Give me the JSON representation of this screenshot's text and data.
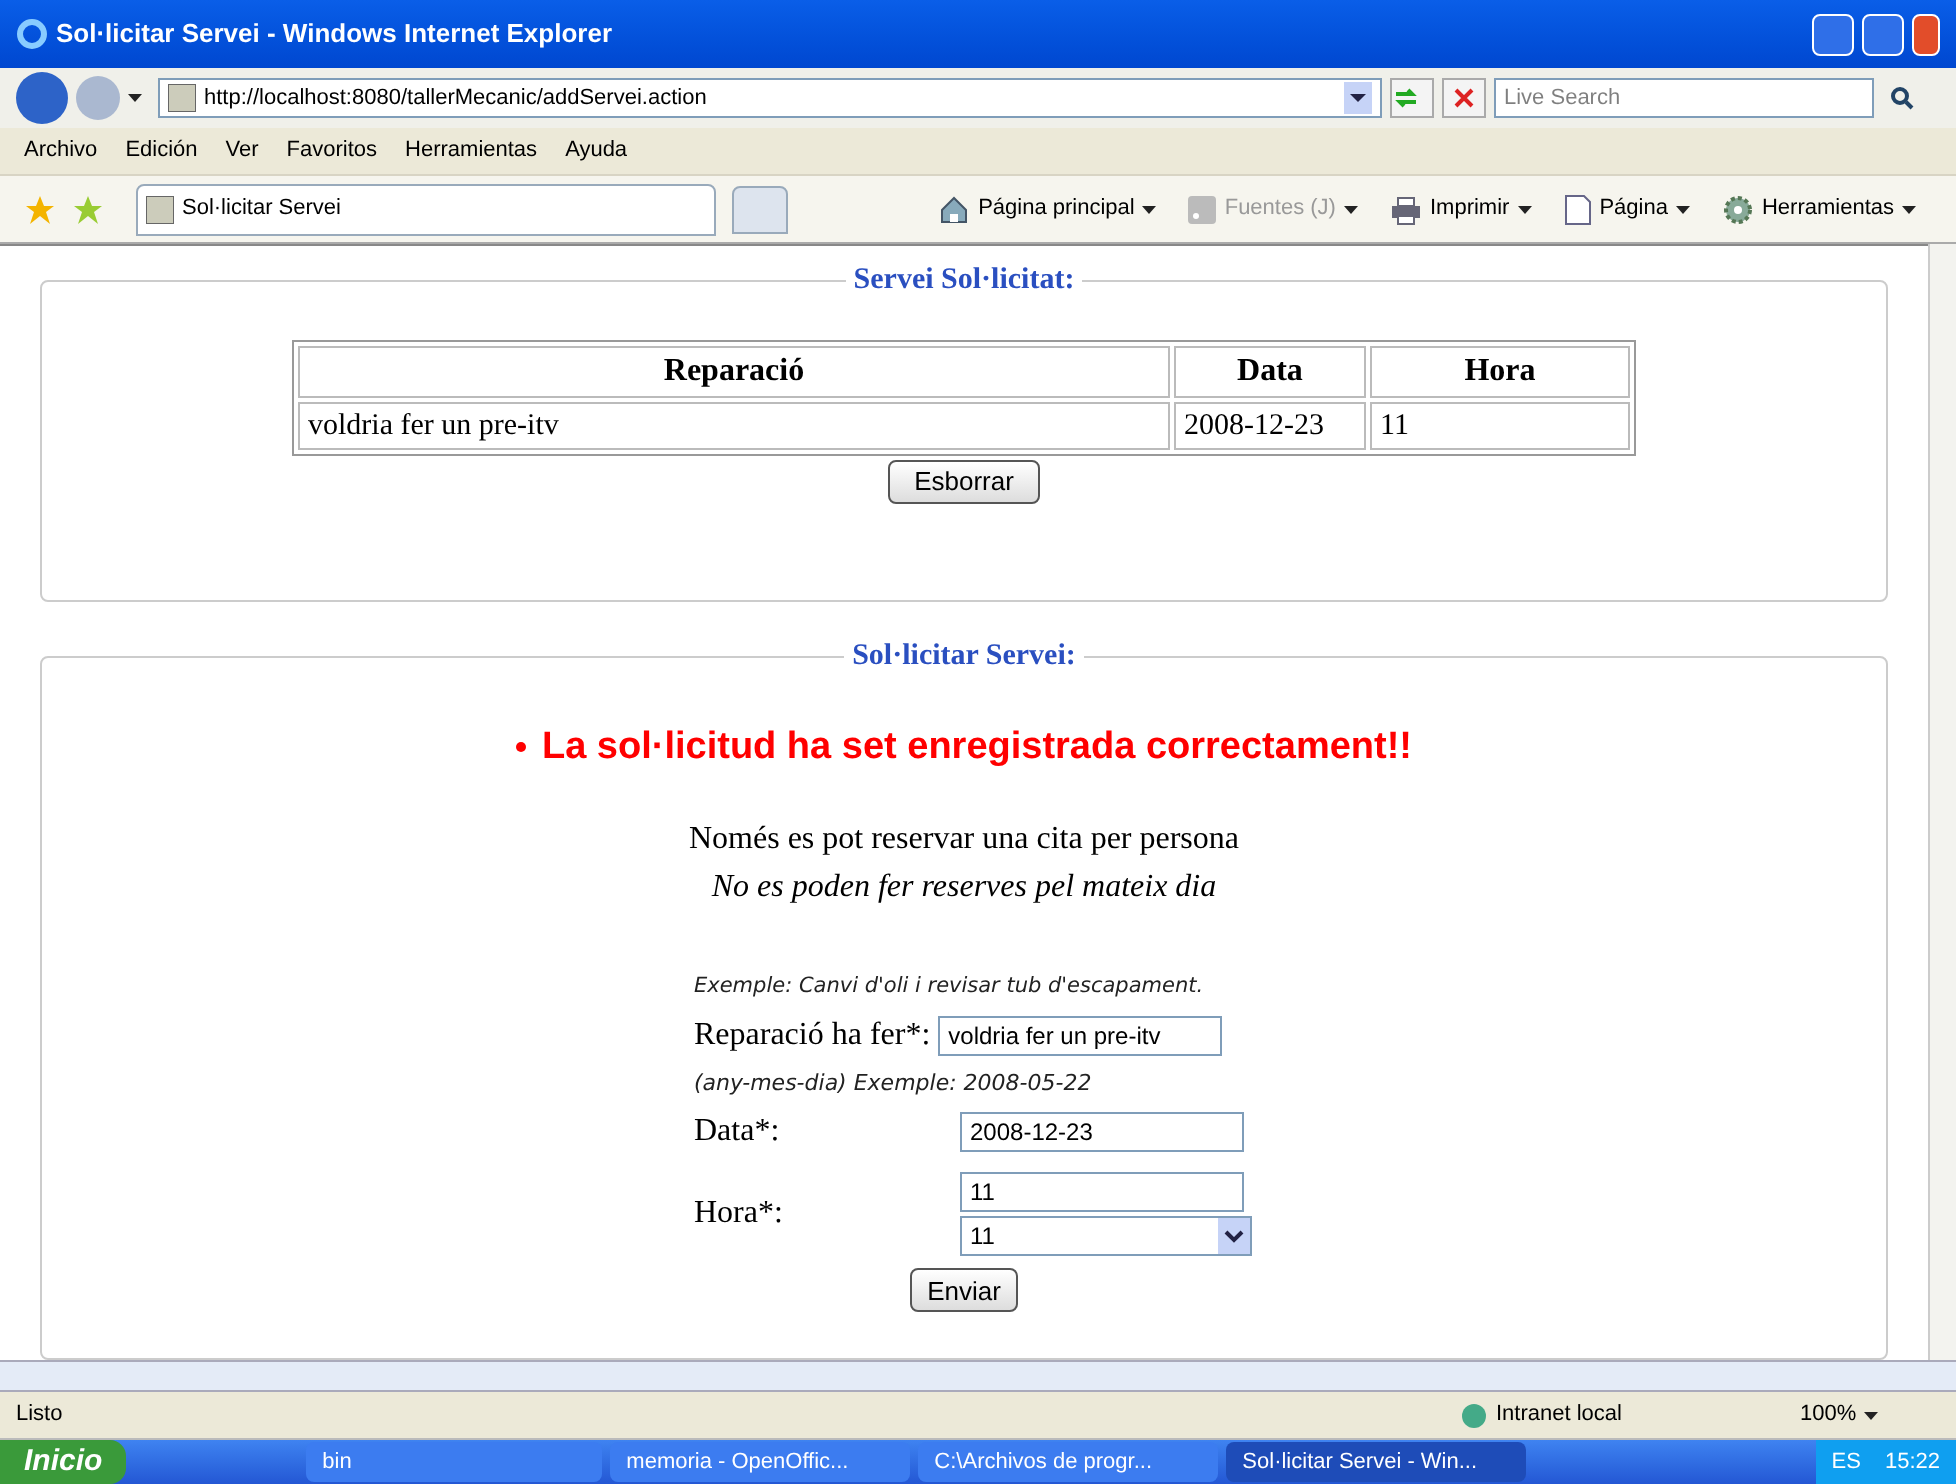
{
  "window": {
    "title": "Sol·licitar Servei - Windows Internet Explorer"
  },
  "address": {
    "url": "http://localhost:8080/tallerMecanic/addServei.action"
  },
  "search": {
    "placeholder": "Live Search"
  },
  "menu": [
    "Archivo",
    "Edición",
    "Ver",
    "Favoritos",
    "Herramientas",
    "Ayuda"
  ],
  "tab": {
    "title": "Sol·licitar Servei"
  },
  "commands": [
    {
      "label": "Página principal",
      "kind": "home",
      "disabled": false
    },
    {
      "label": "Fuentes (J)",
      "kind": "feed",
      "disabled": true
    },
    {
      "label": "Imprimir",
      "kind": "print",
      "disabled": false
    },
    {
      "label": "Página",
      "kind": "page",
      "disabled": false
    },
    {
      "label": "Herramientas",
      "kind": "tools",
      "disabled": false
    }
  ],
  "requested": {
    "legend": "Servei Sol·licitat:",
    "columns": [
      "Reparació",
      "Data",
      "Hora"
    ],
    "rows": [
      [
        "voldria fer un pre-itv",
        "2008-12-23",
        "11"
      ]
    ],
    "button": "Esborrar"
  },
  "request_form": {
    "legend": "Sol·licitar Servei:",
    "message": "La sol·licitud ha set enregistrada correctament!!",
    "note": "Només es pot reservar una cita per persona",
    "note_italic": "No es poden fer reserves pel mateix dia",
    "hint_repair": "Exemple: Canvi d'oli i revisar tub d'escapament.",
    "repair_label": "Reparació ha fer*:",
    "repair_value": "voldria fer un pre-itv",
    "hint_date": "(any-mes-dia) Exemple: 2008-05-22",
    "date_label": "Data*:",
    "date_value": "2008-12-23",
    "hour_label": "Hora*:",
    "hour_value": "11",
    "hour_select": "11",
    "button": "Enviar"
  },
  "status_bar": {
    "text": "Listo",
    "zone": "Intranet local",
    "zoom": "100%"
  },
  "taskbar": {
    "start": "Inicio",
    "tasks": [
      {
        "label": "bin",
        "selected": false
      },
      {
        "label": "memoria - OpenOffic...",
        "selected": false
      },
      {
        "label": "C:\\Archivos de progr...",
        "selected": false
      },
      {
        "label": "Sol·licitar Servei - Win...",
        "selected": true
      }
    ],
    "lang": "ES",
    "clock": "15:22"
  }
}
